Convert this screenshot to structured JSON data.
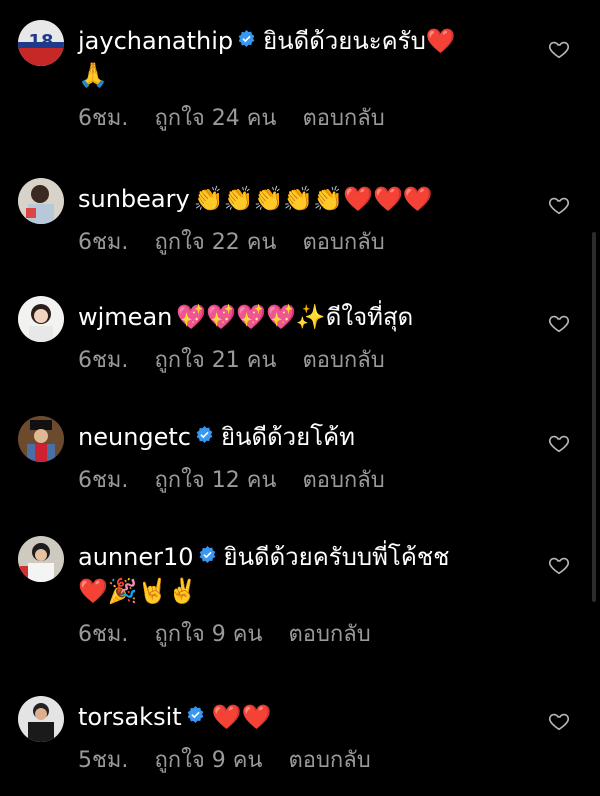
{
  "comments": [
    {
      "username": "jaychanathip",
      "verified": true,
      "text": "ยินดีด้วยนะครับ❤️",
      "text2": "🙏",
      "time": "6ชม.",
      "likes": "ถูกใจ 24 คน",
      "reply": "ตอบกลับ"
    },
    {
      "username": "sunbeary",
      "verified": false,
      "text": "👏👏👏👏👏❤️❤️❤️",
      "text2": "",
      "time": "6ชม.",
      "likes": "ถูกใจ 22 คน",
      "reply": "ตอบกลับ"
    },
    {
      "username": "wjmean",
      "verified": false,
      "text": "💖💖💖💖✨ดีใจที่สุด",
      "text2": "",
      "time": "6ชม.",
      "likes": "ถูกใจ 21 คน",
      "reply": "ตอบกลับ"
    },
    {
      "username": "neungetc",
      "verified": true,
      "text": "ยินดีด้วยโค้ท",
      "text2": "",
      "time": "6ชม.",
      "likes": "ถูกใจ 12 คน",
      "reply": "ตอบกลับ"
    },
    {
      "username": "aunner10",
      "verified": true,
      "text": "ยินดีด้วยครับบพี่โค้ชช",
      "text2": "❤️🎉🤘✌️",
      "time": "6ชม.",
      "likes": "ถูกใจ 9 คน",
      "reply": "ตอบกลับ"
    },
    {
      "username": "torsaksit",
      "verified": true,
      "text": "❤️❤️",
      "text2": "",
      "time": "5ชม.",
      "likes": "ถูกใจ 9 คน",
      "reply": "ตอบกลับ"
    }
  ],
  "avatar_badge": "18",
  "colors": {
    "verified": "#3897f0",
    "meta": "#9a9a9a",
    "background": "#000000"
  },
  "icons": {
    "like": "heart-outline-icon",
    "verified": "verified-badge-icon"
  }
}
